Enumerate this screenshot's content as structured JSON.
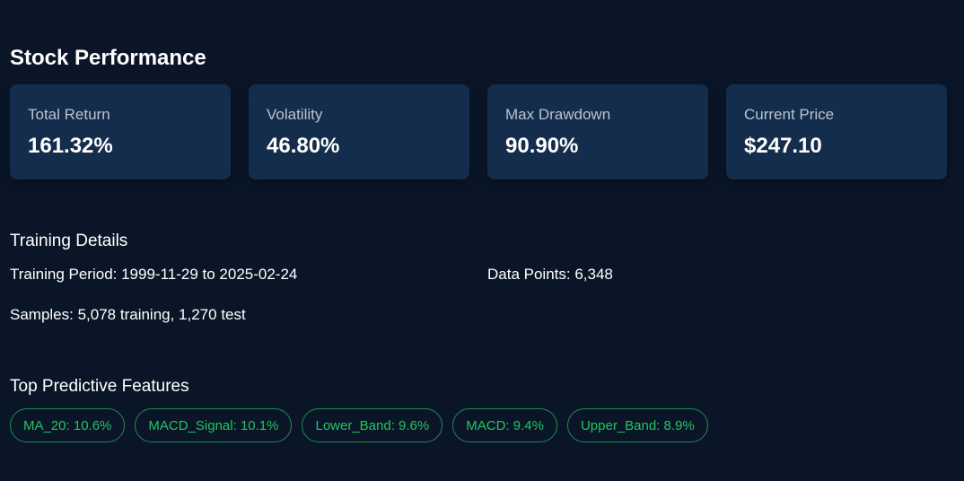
{
  "page_title": "Stock Performance",
  "metrics": [
    {
      "label": "Total Return",
      "value": "161.32%"
    },
    {
      "label": "Volatility",
      "value": "46.80%"
    },
    {
      "label": "Max Drawdown",
      "value": "90.90%"
    },
    {
      "label": "Current Price",
      "value": "$247.10"
    }
  ],
  "training": {
    "title": "Training Details",
    "period": "Training Period: 1999-11-29 to 2025-02-24",
    "data_points": "Data Points: 6,348",
    "samples": "Samples: 5,078 training, 1,270 test"
  },
  "features": {
    "title": "Top Predictive Features",
    "items": [
      "MA_20: 10.6%",
      "MACD_Signal: 10.1%",
      "Lower_Band: 9.6%",
      "MACD: 9.4%",
      "Upper_Band: 8.9%"
    ]
  },
  "colors": {
    "background": "#0a1628",
    "card": "#142d4c",
    "accent_green": "#22c55e"
  }
}
